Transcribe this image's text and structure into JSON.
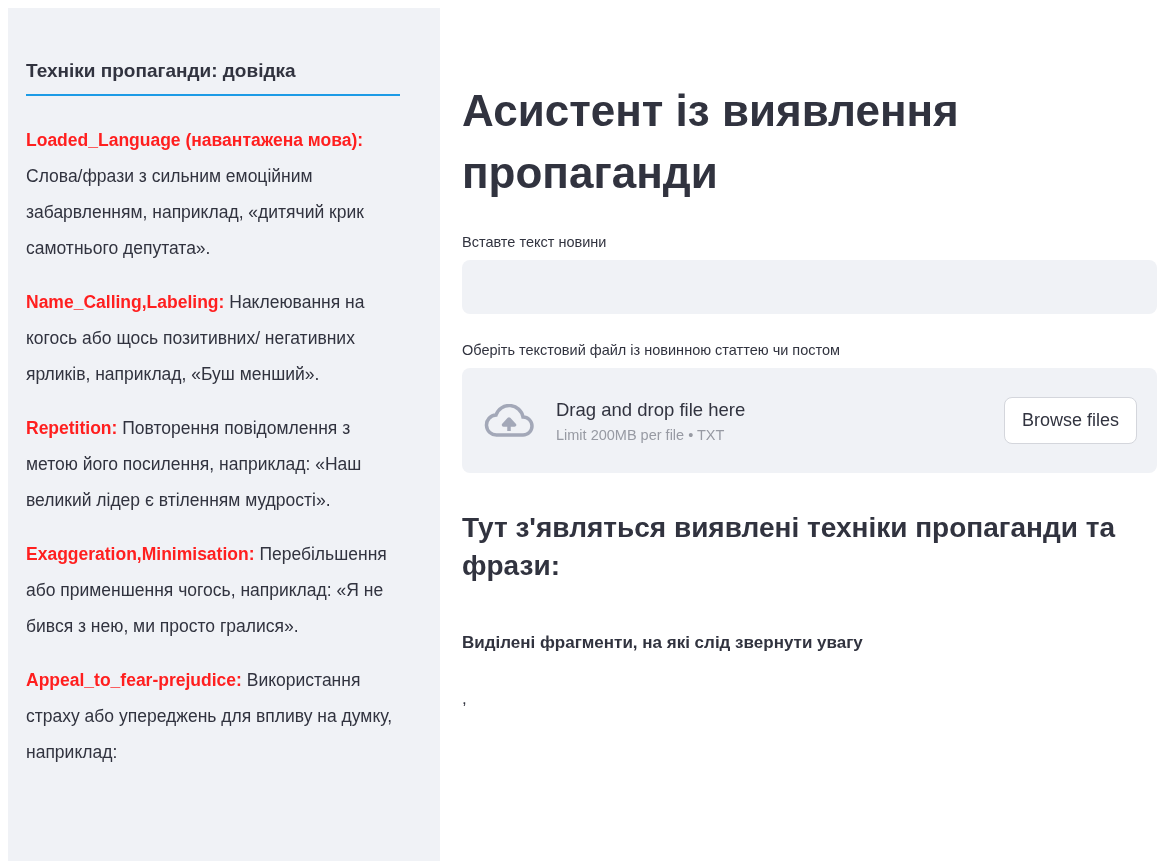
{
  "sidebar": {
    "title": "Техніки пропаганди: довідка",
    "entries": [
      {
        "term": "Loaded_Language (навантажена мова):",
        "description": "Слова/фрази з сильним емоційним забарвленням, наприклад, «дитячий крик самотнього депутата»."
      },
      {
        "term": "Name_Calling,Labeling:",
        "description": "Наклеювання на когось або щось позитивних/ негативних ярликів, наприклад, «Буш менший»."
      },
      {
        "term": "Repetition:",
        "description": "Повторення повідомлення з метою його посилення, наприклад: «Наш великий лідер є втіленням мудрості»."
      },
      {
        "term": "Exaggeration,Minimisation:",
        "description": "Перебільшення або применшення чогось, наприклад: «Я не бився з нею, ми просто гралися»."
      },
      {
        "term": "Appeal_to_fear-prejudice:",
        "description": "Використання страху або упереджень для впливу на думку, наприклад:"
      }
    ]
  },
  "main": {
    "title": "Асистент із виявлення пропаганди",
    "text_input": {
      "label": "Вставте текст новини"
    },
    "file_uploader": {
      "label": "Оберіть текстовий файл із новинною статтею чи постом",
      "prompt": "Drag and drop file here",
      "limit": "Limit 200MB per file • TXT",
      "button": "Browse files"
    },
    "results_heading": "Тут з'являться виявлені техніки пропаганди та фрази:",
    "highlights_heading": "Виділені фрагменти, на які слід звернути увагу",
    "highlights_output": ","
  }
}
